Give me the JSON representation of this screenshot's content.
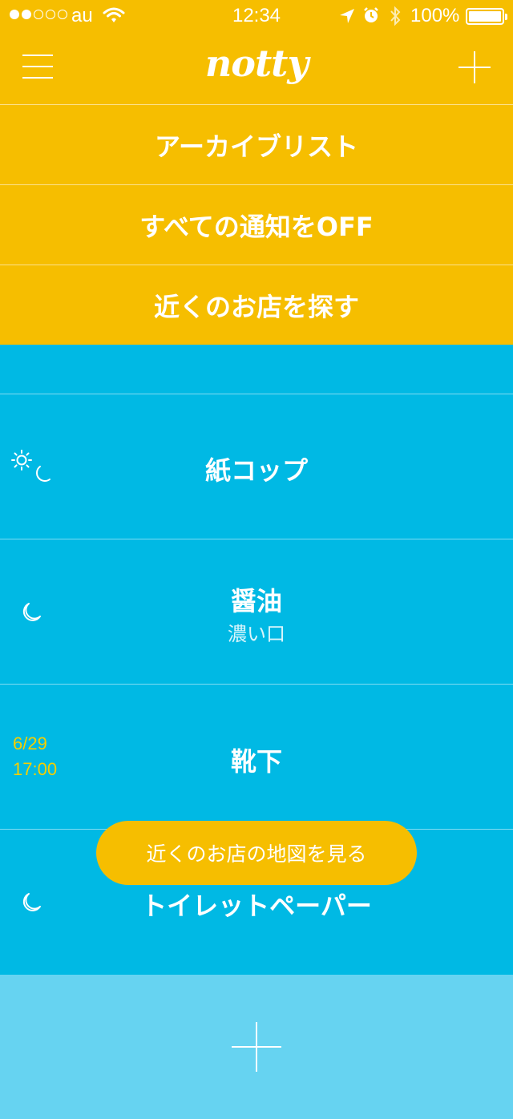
{
  "status_bar": {
    "signal_dots_filled": 2,
    "signal_dots_total": 5,
    "carrier": "au",
    "time": "12:34",
    "battery": "100%"
  },
  "navbar": {
    "logo": "notty",
    "icons": [
      "hamburger-menu-icon",
      "plus-icon"
    ]
  },
  "menu": {
    "items": [
      {
        "label": "アーカイブリスト"
      },
      {
        "label": "すべての通知をOFF"
      },
      {
        "label": "近くのお店を探す"
      }
    ]
  },
  "list": {
    "items": [
      {
        "title": "紙コップ",
        "subtitle": "",
        "icon": "sun-moon-icon"
      },
      {
        "title": "醤油",
        "subtitle": "濃い口",
        "icon": "moon-icon"
      },
      {
        "title": "靴下",
        "subtitle": "",
        "date": "6/29",
        "time": "17:00"
      },
      {
        "title": "トイレットペーパー",
        "subtitle": "",
        "icon": "moon-icon"
      }
    ]
  },
  "map_button": {
    "label": "近くのお店の地図を見る"
  },
  "colors": {
    "accent_yellow": "#f6be00",
    "list_blue": "#00b9e4",
    "add_area_blue": "#66d3f1",
    "date_yellow": "#f6cf00"
  }
}
